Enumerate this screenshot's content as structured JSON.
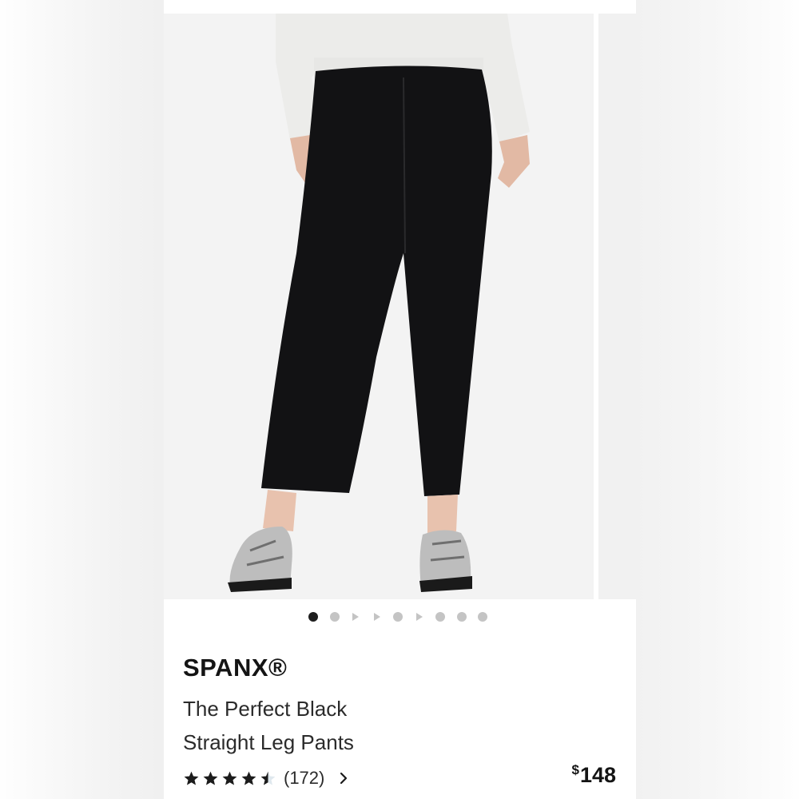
{
  "carousel": {
    "image_alt": "Model wearing black straight leg pants with white sweater and snakeskin loafers",
    "indicators": [
      "dot-active",
      "dot",
      "video",
      "video",
      "dot",
      "video",
      "dot",
      "dot",
      "dot"
    ],
    "active_index": 0
  },
  "product": {
    "brand": "SPANX®",
    "title_line1": "The Perfect Black",
    "title_line2": "Straight Leg Pants",
    "rating": 4.5,
    "rating_max": 5,
    "review_count": "(172)",
    "price_currency": "$",
    "price_amount": "148"
  },
  "colors": {
    "star_filled": "#1b1b1b",
    "star_empty": "#dfe8ee",
    "dot_active": "#1e1e1e",
    "dot_inactive": "#c4c4c4"
  },
  "icons": {
    "rating": "star-icon",
    "reviews_link": "chevron-right-icon"
  }
}
